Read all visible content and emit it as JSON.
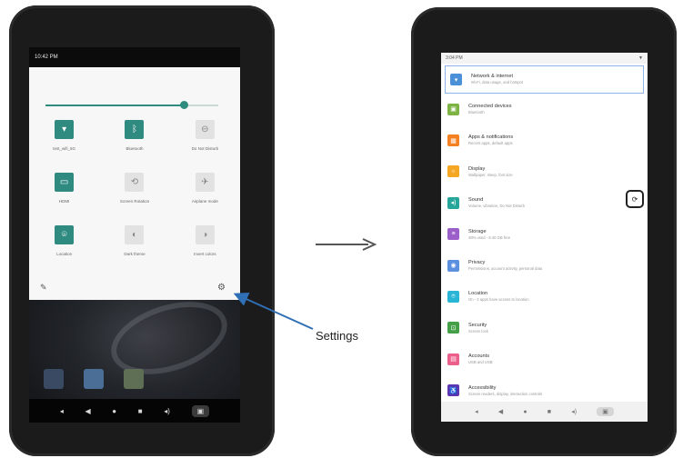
{
  "left_device": {
    "status_time": "10:42 PM",
    "brightness_level": 0.8,
    "tiles": [
      {
        "label": "test_wifi_5G",
        "icon": "wifi-icon",
        "glyph": "▾",
        "active": true
      },
      {
        "label": "Bluetooth",
        "icon": "bluetooth-icon",
        "glyph": "ᛒ",
        "active": true
      },
      {
        "label": "Do Not Disturb",
        "icon": "do-not-disturb-icon",
        "glyph": "⊖",
        "active": false
      },
      {
        "label": "HDMI",
        "icon": "hdmi-icon",
        "glyph": "▭",
        "active": true
      },
      {
        "label": "Screen Rotation",
        "icon": "rotate-icon",
        "glyph": "⟲",
        "active": false
      },
      {
        "label": "Airplane mode",
        "icon": "airplane-icon",
        "glyph": "✈",
        "active": false
      },
      {
        "label": "Location",
        "icon": "location-icon",
        "glyph": "⌾",
        "active": true
      },
      {
        "label": "Dark theme",
        "icon": "dark-theme-icon",
        "glyph": "◐",
        "active": false
      },
      {
        "label": "Invert colors",
        "icon": "invert-colors-icon",
        "glyph": "◑",
        "active": false
      }
    ],
    "edit_glyph": "✎",
    "settings_glyph": "⚙",
    "nav": [
      "◂",
      "◀",
      "●",
      "■",
      "◂)",
      "▣"
    ]
  },
  "callout": {
    "label": "Settings"
  },
  "right_device": {
    "status_time": "3:04 PM",
    "status_right": "▼",
    "settings_items": [
      {
        "title": "Network & internet",
        "subtitle": "Wi-Fi, data usage, and hotspot",
        "color": "#4a90d9",
        "icon": "network-icon",
        "glyph": "▾"
      },
      {
        "title": "Connected devices",
        "subtitle": "Bluetooth",
        "color": "#7cb342",
        "icon": "connected-devices-icon",
        "glyph": "▣"
      },
      {
        "title": "Apps & notifications",
        "subtitle": "Recent apps, default apps",
        "color": "#f4801f",
        "icon": "apps-icon",
        "glyph": "▦"
      },
      {
        "title": "Display",
        "subtitle": "Wallpaper, sleep, font size",
        "color": "#f5a623",
        "icon": "display-icon",
        "glyph": "☼"
      },
      {
        "title": "Sound",
        "subtitle": "Volume, vibration, Do Not Disturb",
        "color": "#26a69a",
        "icon": "sound-icon",
        "glyph": "◂)"
      },
      {
        "title": "Storage",
        "subtitle": "48% used - 8.40 GB free",
        "color": "#9c5fc9",
        "icon": "storage-icon",
        "glyph": "≡"
      },
      {
        "title": "Privacy",
        "subtitle": "Permissions, account activity, personal data",
        "color": "#5b8fe0",
        "icon": "privacy-icon",
        "glyph": "◉"
      },
      {
        "title": "Location",
        "subtitle": "On - 3 apps have access to location",
        "color": "#29b6d6",
        "icon": "location-icon",
        "glyph": "⌾"
      },
      {
        "title": "Security",
        "subtitle": "Screen lock",
        "color": "#43a047",
        "icon": "security-icon",
        "glyph": "⊡"
      },
      {
        "title": "Accounts",
        "subtitle": "USB and USB",
        "color": "#ec5f8a",
        "icon": "accounts-icon",
        "glyph": "▤"
      },
      {
        "title": "Accessibility",
        "subtitle": "Screen readers, display, interaction controls",
        "color": "#5e35b1",
        "icon": "accessibility-icon",
        "glyph": "♿"
      }
    ],
    "side_button_glyph": "⟳",
    "nav": [
      "◂",
      "◀",
      "●",
      "■",
      "◂)",
      "▣"
    ]
  }
}
